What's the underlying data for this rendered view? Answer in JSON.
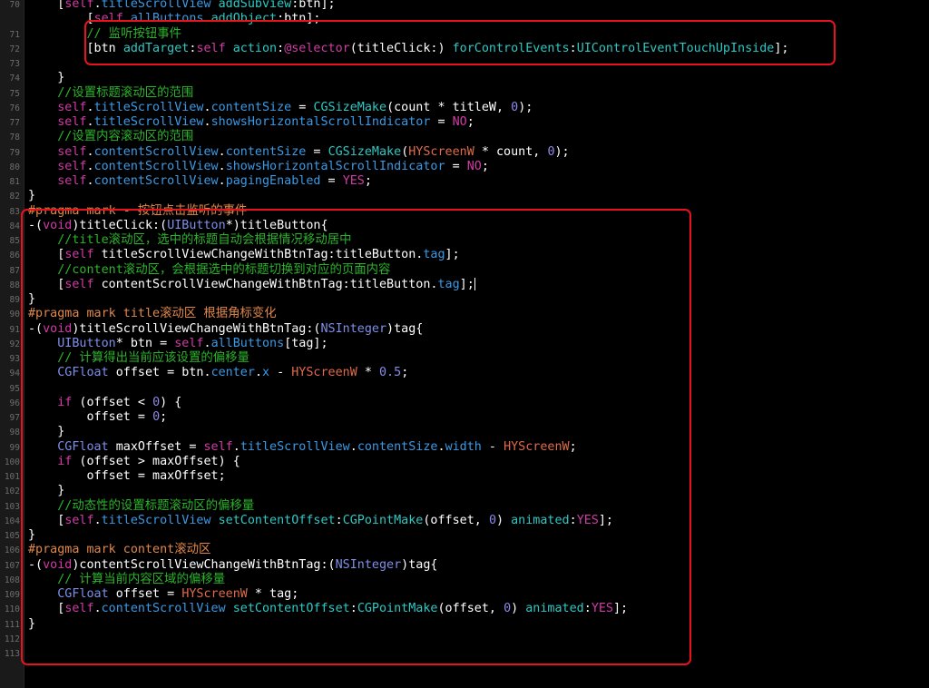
{
  "colors": {
    "default": "#ffffff",
    "keyword": "#d13ba6",
    "property": "#3a9ae6",
    "type": "#7f8fe8",
    "method": "#2fc8c4",
    "comment": "#2cb32c",
    "preprocessor": "#e08748",
    "number": "#8b8ae8",
    "macro": "#e06a4a",
    "background": "#000000",
    "gutter_text": "#6e6e6e",
    "highlight_box": "#e8141c"
  },
  "lines": [
    {
      "n": "70",
      "t": [
        [
          "    [",
          "d"
        ],
        [
          "self",
          "k"
        ],
        [
          ".",
          "d"
        ],
        [
          "titleScrollView",
          "p"
        ],
        [
          " ",
          "d"
        ],
        [
          "addSubview",
          "m"
        ],
        [
          ":btn];",
          "d"
        ]
      ]
    },
    {
      "n": "",
      "t": [
        [
          "        [",
          "d"
        ],
        [
          "self",
          "k"
        ],
        [
          ".",
          "d"
        ],
        [
          "allButtons",
          "p"
        ],
        [
          " ",
          "d"
        ],
        [
          "addObject",
          "m"
        ],
        [
          ":btn];",
          "d"
        ]
      ]
    },
    {
      "n": "71",
      "t": [
        [
          "        ",
          "d"
        ],
        [
          "// 监听按钮事件",
          "c"
        ]
      ]
    },
    {
      "n": "72",
      "t": [
        [
          "        [btn ",
          "d"
        ],
        [
          "addTarget",
          "m"
        ],
        [
          ":",
          "d"
        ],
        [
          "self",
          "k"
        ],
        [
          " ",
          "d"
        ],
        [
          "action",
          "m"
        ],
        [
          ":",
          "d"
        ],
        [
          "@selector",
          "k"
        ],
        [
          "(titleClick:) ",
          "d"
        ],
        [
          "forControlEvents",
          "m"
        ],
        [
          ":",
          "d"
        ],
        [
          "UIControlEventTouchUpInside",
          "m"
        ],
        [
          "];",
          "d"
        ]
      ]
    },
    {
      "n": "73",
      "t": [
        [
          "",
          "d"
        ]
      ]
    },
    {
      "n": "74",
      "t": [
        [
          "    }",
          "d"
        ]
      ]
    },
    {
      "n": "75",
      "t": [
        [
          "    ",
          "d"
        ],
        [
          "//设置标题滚动区的范围",
          "c"
        ]
      ]
    },
    {
      "n": "76",
      "t": [
        [
          "    ",
          "d"
        ],
        [
          "self",
          "k"
        ],
        [
          ".",
          "d"
        ],
        [
          "titleScrollView",
          "p"
        ],
        [
          ".",
          "d"
        ],
        [
          "contentSize",
          "p"
        ],
        [
          " = ",
          "d"
        ],
        [
          "CGSizeMake",
          "m"
        ],
        [
          "(count * titleW, ",
          "d"
        ],
        [
          "0",
          "n"
        ],
        [
          ");",
          "d"
        ]
      ]
    },
    {
      "n": "77",
      "t": [
        [
          "    ",
          "d"
        ],
        [
          "self",
          "k"
        ],
        [
          ".",
          "d"
        ],
        [
          "titleScrollView",
          "p"
        ],
        [
          ".",
          "d"
        ],
        [
          "showsHorizontalScrollIndicator",
          "p"
        ],
        [
          " = ",
          "d"
        ],
        [
          "NO",
          "k"
        ],
        [
          ";",
          "d"
        ]
      ]
    },
    {
      "n": "78",
      "t": [
        [
          "    ",
          "d"
        ],
        [
          "//设置内容滚动区的范围",
          "c"
        ]
      ]
    },
    {
      "n": "79",
      "t": [
        [
          "    ",
          "d"
        ],
        [
          "self",
          "k"
        ],
        [
          ".",
          "d"
        ],
        [
          "contentScrollView",
          "p"
        ],
        [
          ".",
          "d"
        ],
        [
          "contentSize",
          "p"
        ],
        [
          " = ",
          "d"
        ],
        [
          "CGSizeMake",
          "m"
        ],
        [
          "(",
          "d"
        ],
        [
          "HYScreenW",
          "x"
        ],
        [
          " * count, ",
          "d"
        ],
        [
          "0",
          "n"
        ],
        [
          ");",
          "d"
        ]
      ]
    },
    {
      "n": "80",
      "t": [
        [
          "    ",
          "d"
        ],
        [
          "self",
          "k"
        ],
        [
          ".",
          "d"
        ],
        [
          "contentScrollView",
          "p"
        ],
        [
          ".",
          "d"
        ],
        [
          "showsHorizontalScrollIndicator",
          "p"
        ],
        [
          " = ",
          "d"
        ],
        [
          "NO",
          "k"
        ],
        [
          ";",
          "d"
        ]
      ]
    },
    {
      "n": "81",
      "t": [
        [
          "    ",
          "d"
        ],
        [
          "self",
          "k"
        ],
        [
          ".",
          "d"
        ],
        [
          "contentScrollView",
          "p"
        ],
        [
          ".",
          "d"
        ],
        [
          "pagingEnabled",
          "p"
        ],
        [
          " = ",
          "d"
        ],
        [
          "YES",
          "k"
        ],
        [
          ";",
          "d"
        ]
      ]
    },
    {
      "n": "82",
      "t": [
        [
          "}",
          "d"
        ]
      ]
    },
    {
      "n": "83",
      "t": [
        [
          "#pragma mark - 按钮点击监听的事件",
          "r"
        ]
      ]
    },
    {
      "n": "84",
      "t": [
        [
          "-(",
          "d"
        ],
        [
          "void",
          "k"
        ],
        [
          ")titleClick:(",
          "d"
        ],
        [
          "UIButton",
          "y"
        ],
        [
          "*)titleButton{",
          "d"
        ]
      ]
    },
    {
      "n": "85",
      "t": [
        [
          "    ",
          "d"
        ],
        [
          "//title滚动区，选中的标题自动会根据情况移动居中",
          "c"
        ]
      ]
    },
    {
      "n": "86",
      "t": [
        [
          "    [",
          "d"
        ],
        [
          "self",
          "k"
        ],
        [
          " titleScrollViewChangeWithBtnTag:",
          "d"
        ],
        [
          "titleButton.",
          "d"
        ],
        [
          "tag",
          "p"
        ],
        [
          "];",
          "d"
        ]
      ]
    },
    {
      "n": "87",
      "t": [
        [
          "    ",
          "d"
        ],
        [
          "//content滚动区，会根据选中的标题切换到对应的页面内容",
          "c"
        ]
      ]
    },
    {
      "n": "88",
      "t": [
        [
          "    [",
          "d"
        ],
        [
          "self",
          "k"
        ],
        [
          " contentScrollViewChangeWithBtnTag:",
          "d"
        ],
        [
          "titleButton.",
          "d"
        ],
        [
          "tag",
          "p"
        ],
        [
          "];",
          "d"
        ]
      ]
    },
    {
      "n": "89",
      "t": [
        [
          "}",
          "d"
        ]
      ]
    },
    {
      "n": "90",
      "t": [
        [
          "#pragma mark title滚动区 根据角标变化",
          "r"
        ]
      ]
    },
    {
      "n": "91",
      "t": [
        [
          "-(",
          "d"
        ],
        [
          "void",
          "k"
        ],
        [
          ")titleScrollViewChangeWithBtnTag:(",
          "d"
        ],
        [
          "NSInteger",
          "y"
        ],
        [
          ")tag{",
          "d"
        ]
      ]
    },
    {
      "n": "92",
      "t": [
        [
          "    ",
          "d"
        ],
        [
          "UIButton",
          "y"
        ],
        [
          "* btn = ",
          "d"
        ],
        [
          "self",
          "k"
        ],
        [
          ".",
          "d"
        ],
        [
          "allButtons",
          "p"
        ],
        [
          "[tag];",
          "d"
        ]
      ]
    },
    {
      "n": "93",
      "t": [
        [
          "    ",
          "d"
        ],
        [
          "// 计算得出当前应该设置的偏移量",
          "c"
        ]
      ]
    },
    {
      "n": "94",
      "t": [
        [
          "    ",
          "d"
        ],
        [
          "CGFloat",
          "y"
        ],
        [
          " offset = btn.",
          "d"
        ],
        [
          "center",
          "p"
        ],
        [
          ".",
          "d"
        ],
        [
          "x",
          "p"
        ],
        [
          " - ",
          "d"
        ],
        [
          "HYScreenW",
          "x"
        ],
        [
          " * ",
          "d"
        ],
        [
          "0.5",
          "n"
        ],
        [
          ";",
          "d"
        ]
      ]
    },
    {
      "n": "95",
      "t": [
        [
          "",
          "d"
        ]
      ]
    },
    {
      "n": "96",
      "t": [
        [
          "    ",
          "d"
        ],
        [
          "if",
          "k"
        ],
        [
          " (offset < ",
          "d"
        ],
        [
          "0",
          "n"
        ],
        [
          ") {",
          "d"
        ]
      ]
    },
    {
      "n": "97",
      "t": [
        [
          "        offset = ",
          "d"
        ],
        [
          "0",
          "n"
        ],
        [
          ";",
          "d"
        ]
      ]
    },
    {
      "n": "98",
      "t": [
        [
          "    }",
          "d"
        ]
      ]
    },
    {
      "n": "99",
      "t": [
        [
          "    ",
          "d"
        ],
        [
          "CGFloat",
          "y"
        ],
        [
          " maxOffset = ",
          "d"
        ],
        [
          "self",
          "k"
        ],
        [
          ".",
          "d"
        ],
        [
          "titleScrollView",
          "p"
        ],
        [
          ".",
          "d"
        ],
        [
          "contentSize",
          "p"
        ],
        [
          ".",
          "d"
        ],
        [
          "width",
          "p"
        ],
        [
          " - ",
          "d"
        ],
        [
          "HYScreenW",
          "x"
        ],
        [
          ";",
          "d"
        ]
      ]
    },
    {
      "n": "100",
      "t": [
        [
          "    ",
          "d"
        ],
        [
          "if",
          "k"
        ],
        [
          " (offset > maxOffset) {",
          "d"
        ]
      ]
    },
    {
      "n": "101",
      "t": [
        [
          "        offset = maxOffset;",
          "d"
        ]
      ]
    },
    {
      "n": "102",
      "t": [
        [
          "    }",
          "d"
        ]
      ]
    },
    {
      "n": "103",
      "t": [
        [
          "    ",
          "d"
        ],
        [
          "//动态性的设置标题滚动区的偏移量",
          "c"
        ]
      ]
    },
    {
      "n": "104",
      "t": [
        [
          "    [",
          "d"
        ],
        [
          "self",
          "k"
        ],
        [
          ".",
          "d"
        ],
        [
          "titleScrollView",
          "p"
        ],
        [
          " ",
          "d"
        ],
        [
          "setContentOffset",
          "m"
        ],
        [
          ":",
          "d"
        ],
        [
          "CGPointMake",
          "m"
        ],
        [
          "(offset, ",
          "d"
        ],
        [
          "0",
          "n"
        ],
        [
          ") ",
          "d"
        ],
        [
          "animated",
          "m"
        ],
        [
          ":",
          "d"
        ],
        [
          "YES",
          "k"
        ],
        [
          "];",
          "d"
        ]
      ]
    },
    {
      "n": "105",
      "t": [
        [
          "}",
          "d"
        ]
      ]
    },
    {
      "n": "106",
      "t": [
        [
          "#pragma mark content滚动区",
          "r"
        ]
      ]
    },
    {
      "n": "107",
      "t": [
        [
          "-(",
          "d"
        ],
        [
          "void",
          "k"
        ],
        [
          ")contentScrollViewChangeWithBtnTag:(",
          "d"
        ],
        [
          "NSInteger",
          "y"
        ],
        [
          ")tag{",
          "d"
        ]
      ]
    },
    {
      "n": "108",
      "t": [
        [
          "    ",
          "d"
        ],
        [
          "// 计算当前内容区域的偏移量",
          "c"
        ]
      ]
    },
    {
      "n": "109",
      "t": [
        [
          "    ",
          "d"
        ],
        [
          "CGFloat",
          "y"
        ],
        [
          " offset = ",
          "d"
        ],
        [
          "HYScreenW",
          "x"
        ],
        [
          " * tag;",
          "d"
        ]
      ]
    },
    {
      "n": "110",
      "t": [
        [
          "    [",
          "d"
        ],
        [
          "self",
          "k"
        ],
        [
          ".",
          "d"
        ],
        [
          "contentScrollView",
          "p"
        ],
        [
          " ",
          "d"
        ],
        [
          "setContentOffset",
          "m"
        ],
        [
          ":",
          "d"
        ],
        [
          "CGPointMake",
          "m"
        ],
        [
          "(offset, ",
          "d"
        ],
        [
          "0",
          "n"
        ],
        [
          ") ",
          "d"
        ],
        [
          "animated",
          "m"
        ],
        [
          ":",
          "d"
        ],
        [
          "YES",
          "k"
        ],
        [
          "];",
          "d"
        ]
      ]
    },
    {
      "n": "111",
      "t": [
        [
          "}",
          "d"
        ]
      ]
    },
    {
      "n": "112",
      "t": [
        [
          "",
          "d"
        ]
      ]
    },
    {
      "n": "113",
      "t": [
        [
          "",
          "d"
        ]
      ]
    }
  ]
}
